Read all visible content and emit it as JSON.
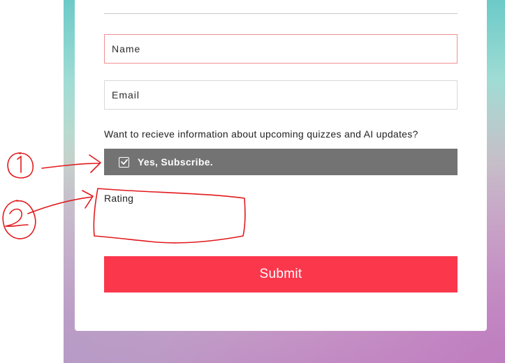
{
  "form": {
    "name_placeholder": "Name",
    "email_placeholder": "Email",
    "subscribe_question": "Want to recieve information about upcoming quizzes and AI updates?",
    "subscribe_option_label": "Yes, Subscribe.",
    "subscribe_checked": true,
    "rating_label": "Rating",
    "submit_label": "Submit"
  },
  "annotations": {
    "marker_1": "1",
    "marker_2": "2"
  },
  "colors": {
    "submit": "#fb374c",
    "subscribe_bar": "#737373",
    "name_border": "#f08f93",
    "annotation": "#e2191c"
  }
}
